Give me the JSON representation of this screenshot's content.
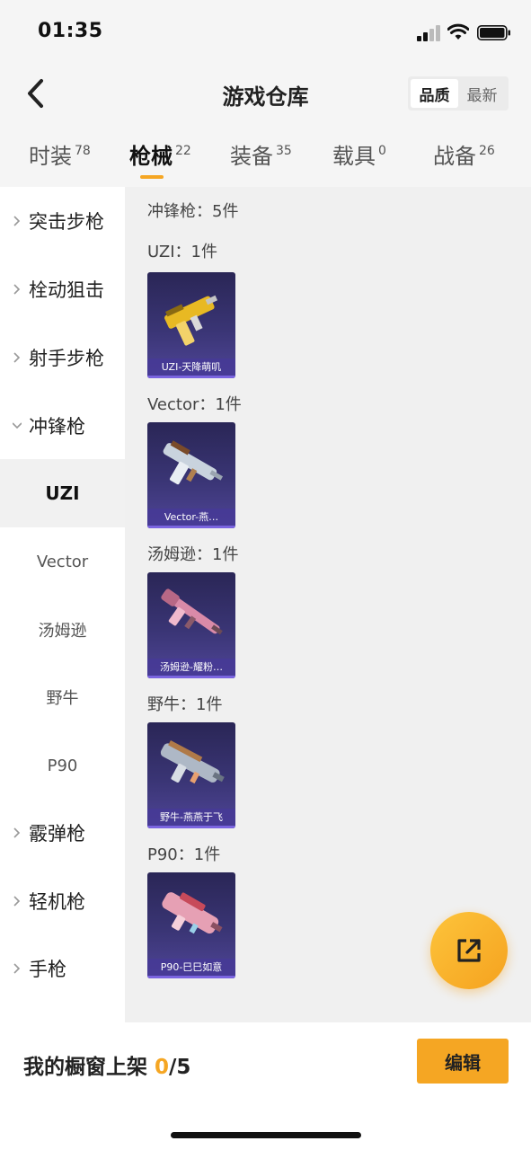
{
  "status_bar": {
    "time": "01:35"
  },
  "header": {
    "title": "游戏仓库",
    "sort_options": [
      "品质",
      "最新"
    ],
    "sort_selected": "品质"
  },
  "tabs": [
    {
      "label": "时装",
      "count": "78"
    },
    {
      "label": "枪械",
      "count": "22"
    },
    {
      "label": "装备",
      "count": "35"
    },
    {
      "label": "载具",
      "count": "0"
    },
    {
      "label": "战备",
      "count": "26"
    }
  ],
  "sidebar": {
    "groups": [
      {
        "label": "突击步枪"
      },
      {
        "label": "栓动狙击"
      },
      {
        "label": "射手步枪"
      },
      {
        "label": "冲锋枪"
      }
    ],
    "subitems": [
      "UZI",
      "Vector",
      "汤姆逊",
      "野牛",
      "P90"
    ],
    "groups_after": [
      {
        "label": "霰弹枪"
      },
      {
        "label": "轻机枪"
      },
      {
        "label": "手枪"
      }
    ]
  },
  "content": {
    "category_summary": "冲锋枪：5件",
    "sections": [
      {
        "heading": "UZI：1件",
        "item_name": "UZI-天降萌叽",
        "gun_color": "#e8b923"
      },
      {
        "heading": "Vector：1件",
        "item_name": "Vector-燕…",
        "gun_color": "#c9d3de"
      },
      {
        "heading": "汤姆逊：1件",
        "item_name": "汤姆逊-耀粉…",
        "gun_color": "#d98aa8"
      },
      {
        "heading": "野牛：1件",
        "item_name": "野牛-燕燕于飞",
        "gun_color": "#aeb8c6"
      },
      {
        "heading": "P90：1件",
        "item_name": "P90-巳巳如意",
        "gun_color": "#e6a0b4"
      }
    ]
  },
  "bottom_bar": {
    "shelf_label": "我的橱窗上架",
    "shelf_current": "0",
    "shelf_total": "/5",
    "edit_label": "编辑"
  },
  "colors": {
    "accent": "#f5a623",
    "card_bg": "#3a3575"
  }
}
